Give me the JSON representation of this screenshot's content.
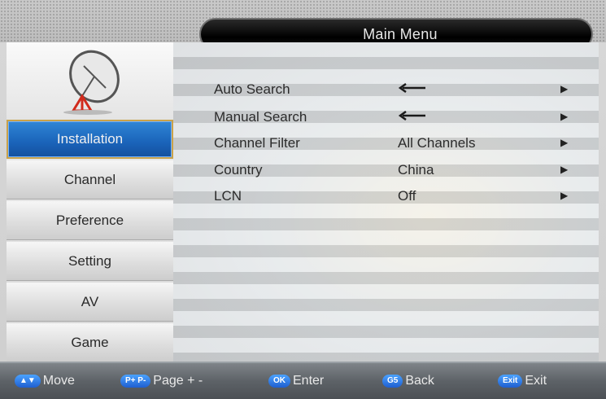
{
  "header": {
    "title": "Main Menu"
  },
  "sidebar": {
    "items": [
      {
        "label": "Installation",
        "active": true
      },
      {
        "label": "Channel"
      },
      {
        "label": "Preference"
      },
      {
        "label": "Setting"
      },
      {
        "label": "AV"
      },
      {
        "label": "Game"
      }
    ]
  },
  "settings": [
    {
      "label": "Auto Search",
      "value_icon": "enter-arrow-icon"
    },
    {
      "label": "Manual Search",
      "value_icon": "enter-arrow-icon"
    },
    {
      "label": "Channel Filter",
      "value": "All Channels"
    },
    {
      "label": "Country",
      "value": "China"
    },
    {
      "label": "LCN",
      "value": "Off"
    }
  ],
  "help": {
    "move_key": "▲▼",
    "move_label": "Move",
    "page_key": "P+ P-",
    "page_label": "Page + -",
    "ok_key": "OK",
    "ok_label": "Enter",
    "back_key": "G5",
    "back_label": "Back",
    "exit_key": "Exit",
    "exit_label": "Exit"
  },
  "colors": {
    "accent": "#1a63b9",
    "highlight_border": "#c9a24a",
    "title_bar": "#000000"
  }
}
